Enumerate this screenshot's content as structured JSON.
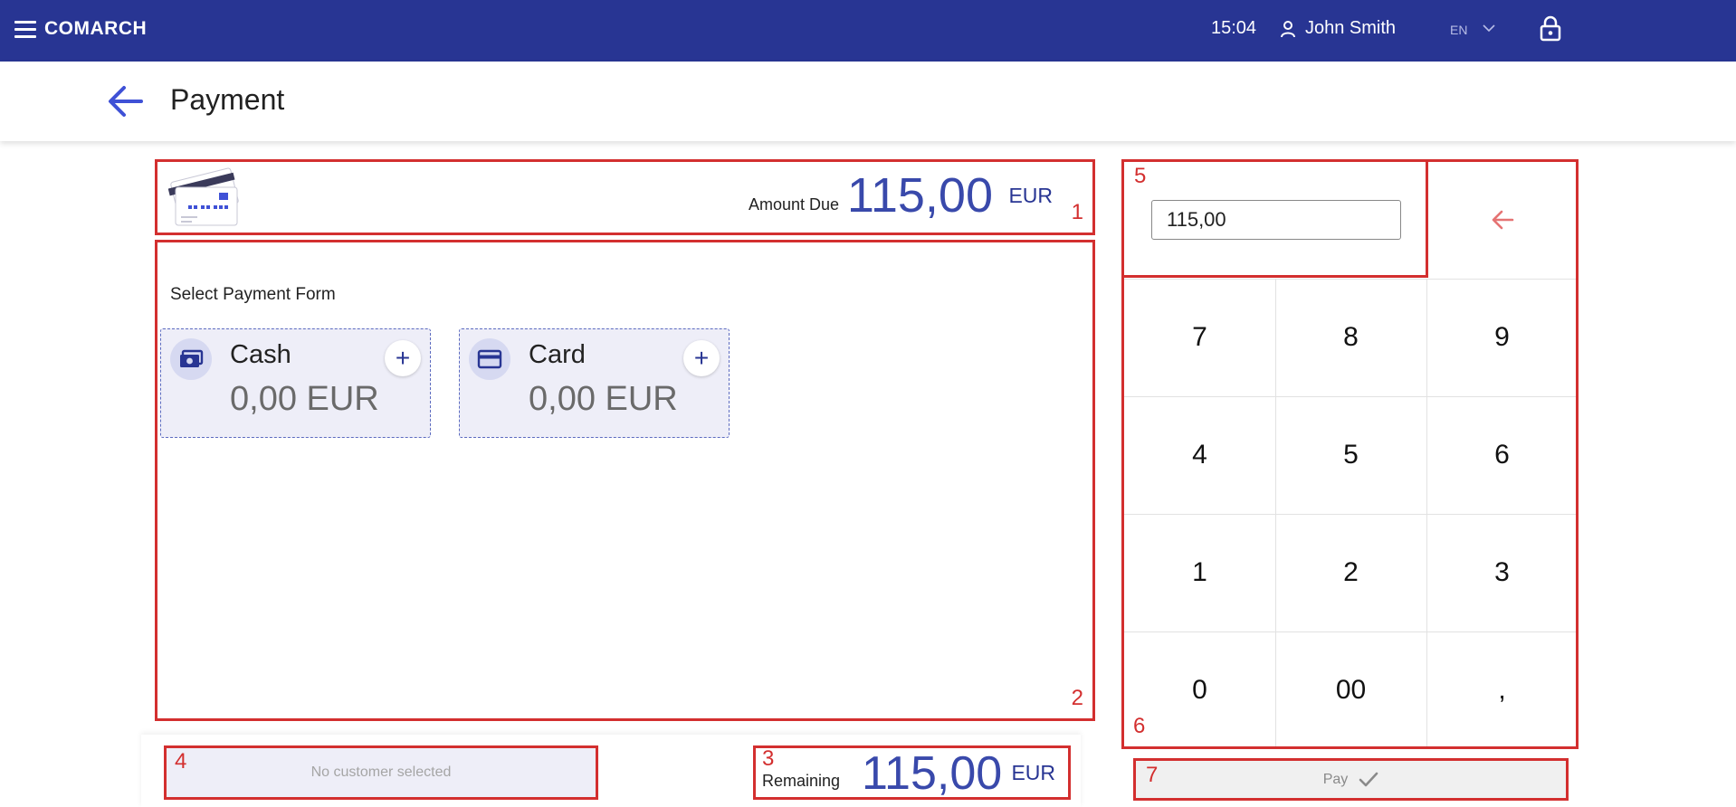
{
  "topbar": {
    "brand": "COMARCH",
    "time": "15:04",
    "user": "John Smith",
    "language": "EN",
    "background_color": "#283593",
    "icons": [
      "menu-icon",
      "user-icon",
      "chevron-down-icon",
      "lock-icon"
    ]
  },
  "header": {
    "title": "Payment",
    "back_icon": "arrow-left-icon"
  },
  "amount_due": {
    "label": "Amount Due",
    "value": "115,00",
    "currency": "EUR"
  },
  "payment_forms": {
    "label": "Select Payment Form",
    "items": [
      {
        "name": "Cash",
        "amount": "0,00 EUR",
        "icon": "cash-icon"
      },
      {
        "name": "Card",
        "amount": "0,00 EUR",
        "icon": "credit-card-icon"
      }
    ]
  },
  "customer": {
    "placeholder": "No customer selected"
  },
  "remaining": {
    "label": "Remaining",
    "value": "115,00",
    "currency": "EUR"
  },
  "numpad": {
    "input_value": "115,00",
    "keys": [
      "7",
      "8",
      "9",
      "4",
      "5",
      "6",
      "1",
      "2",
      "3",
      "0",
      "00",
      ","
    ],
    "backspace_icon": "backspace-arrow-icon"
  },
  "pay_button": {
    "label": "Pay",
    "icon": "check-icon"
  },
  "annotations": [
    "1",
    "2",
    "3",
    "4",
    "5",
    "6",
    "7"
  ],
  "colors": {
    "accent": "#3949ab",
    "highlight_border": "#d32f2f",
    "tile_background": "#eeeef8"
  }
}
